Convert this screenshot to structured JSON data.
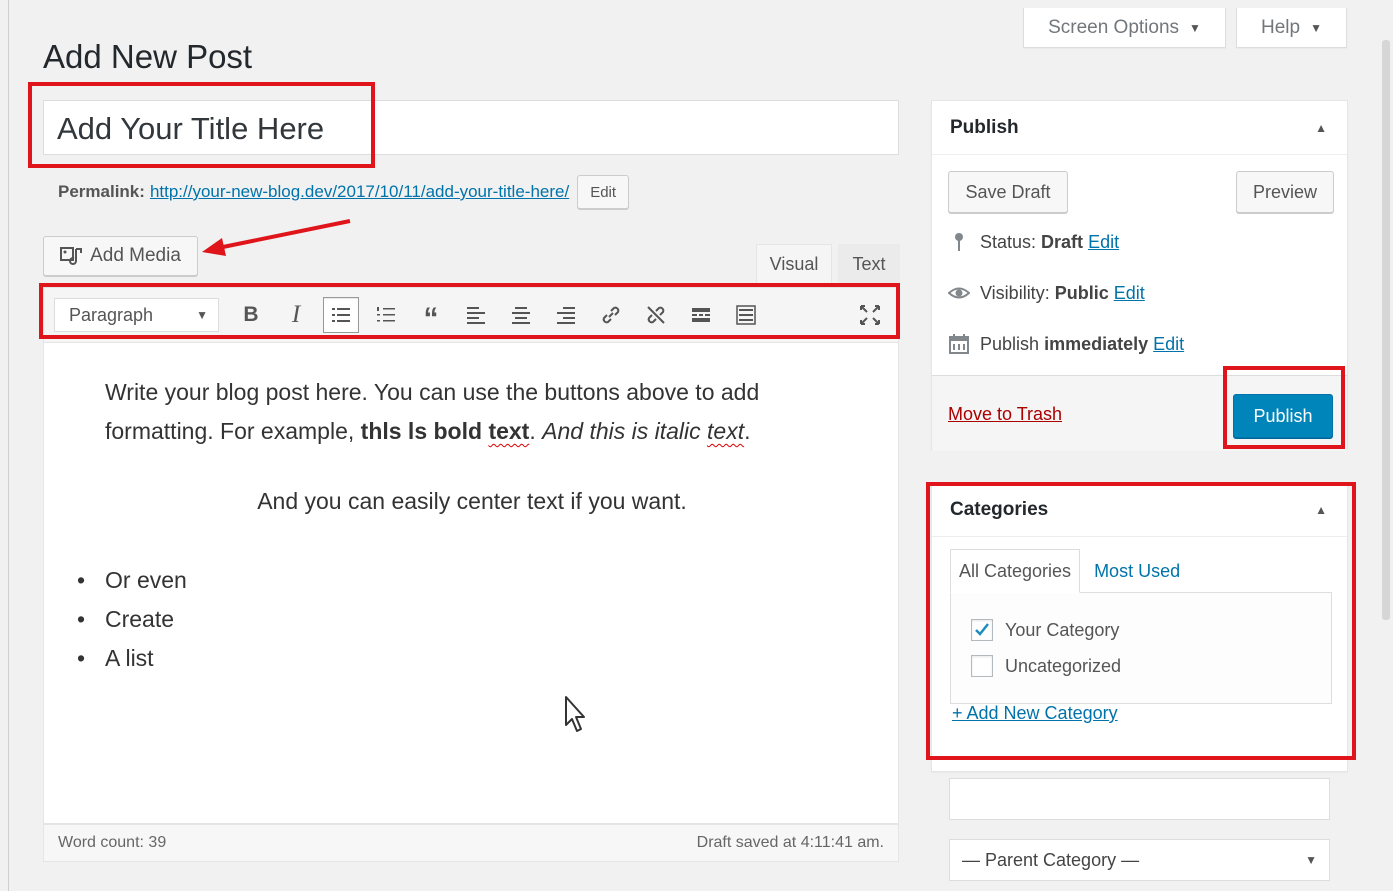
{
  "header": {
    "page_title": "Add New Post",
    "screen_options_label": "Screen Options",
    "help_label": "Help"
  },
  "post": {
    "title": "Add Your Title Here",
    "permalink_label": "Permalink:",
    "permalink_url": "http://your-new-blog.dev/2017/10/11/add-your-title-here/",
    "permalink_edit_label": "Edit"
  },
  "editor": {
    "add_media_label": "Add Media",
    "tabs": {
      "visual": "Visual",
      "text": "Text"
    },
    "format_select": "Paragraph",
    "content": {
      "p1_line1": "Write your blog post here. You can use the buttons above to add",
      "p1_line2_start": "formatting. For example, ",
      "p1_bold_1": "thls ls bold ",
      "p1_bold_2": "text",
      "p1_mid": ". ",
      "p1_italic_1": "And this is italic ",
      "p1_italic_2": "text",
      "p1_end": ".",
      "centered": "And you can easily center text if you want.",
      "list": [
        "Or even",
        "Create",
        "A list"
      ]
    },
    "word_count": "Word count: 39",
    "draft_saved": "Draft saved at 4:11:41 am."
  },
  "publish_box": {
    "title": "Publish",
    "save_draft_label": "Save Draft",
    "preview_label": "Preview",
    "status_label": "Status:",
    "status_value": "Draft",
    "visibility_label": "Visibility:",
    "visibility_value": "Public",
    "publish_label": "Publish",
    "publish_value": "immediately",
    "edit_label": "Edit",
    "move_to_trash_label": "Move to Trash",
    "publish_button_label": "Publish"
  },
  "categories_box": {
    "title": "Categories",
    "tab_all": "All Categories",
    "tab_most_used": "Most Used",
    "items": [
      {
        "label": "Your Category",
        "checked": true
      },
      {
        "label": "Uncategorized",
        "checked": false
      }
    ],
    "add_new_label": "+ Add New Category",
    "parent_select": "— Parent Category —"
  },
  "colors": {
    "accent_blue": "#0085ba",
    "link_blue": "#0073aa",
    "trash_red": "#a00",
    "annotation_red": "#e0151b"
  },
  "icons": [
    "media-icon",
    "bold-icon",
    "italic-icon",
    "bullet-list-icon",
    "numbered-list-icon",
    "blockquote-icon",
    "align-left-icon",
    "align-center-icon",
    "align-right-icon",
    "link-icon",
    "unlink-icon",
    "read-more-icon",
    "toolbar-toggle-icon",
    "fullscreen-icon",
    "pin-icon",
    "eye-icon",
    "calendar-icon",
    "checkmark-icon",
    "cursor-icon"
  ]
}
